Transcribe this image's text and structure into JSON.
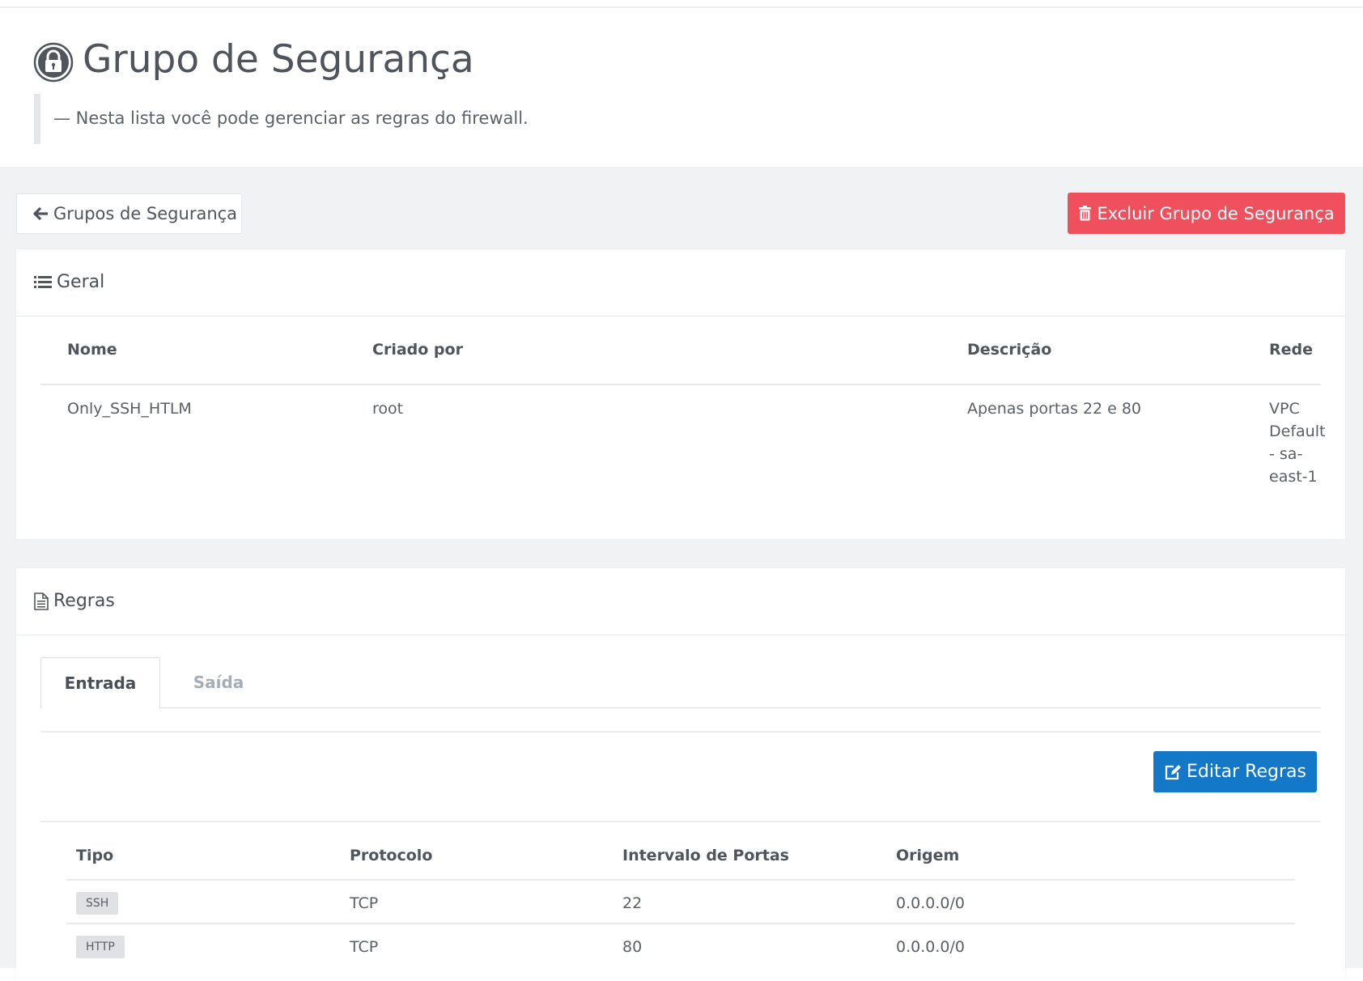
{
  "header": {
    "title": "Grupo de Segurança",
    "subtitle": "— Nesta lista você pode gerenciar as regras do firewall.",
    "icon": "lock-icon"
  },
  "toolbar": {
    "back_label": "Grupos de Segurança",
    "delete_label": "Excluir Grupo de Segurança",
    "delete_color": "#f0505e"
  },
  "general": {
    "title": "Geral",
    "columns": [
      "Nome",
      "Criado por",
      "Descrição",
      "Rede"
    ],
    "row": {
      "nome": "Only_SSH_HTLM",
      "criado_por": "root",
      "descricao": "Apenas portas 22 e 80",
      "rede": "VPC Default - sa-east-1"
    }
  },
  "rules": {
    "title": "Regras",
    "tabs": [
      {
        "label": "Entrada",
        "active": true
      },
      {
        "label": "Saída",
        "active": false
      }
    ],
    "edit_label": "Editar Regras",
    "edit_color": "#1378c8",
    "columns": [
      "Tipo",
      "Protocolo",
      "Intervalo de Portas",
      "Origem"
    ],
    "rows": [
      {
        "tipo": "SSH",
        "protocolo": "TCP",
        "portas": "22",
        "origem": "0.0.0.0/0"
      },
      {
        "tipo": "HTTP",
        "protocolo": "TCP",
        "portas": "80",
        "origem": "0.0.0.0/0"
      }
    ]
  }
}
